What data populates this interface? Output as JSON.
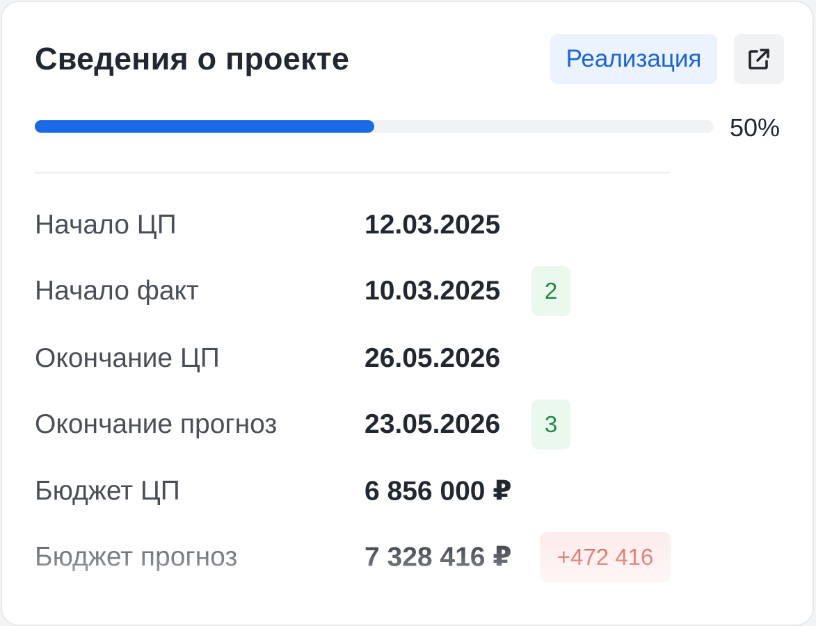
{
  "card": {
    "title": "Сведения о проекте",
    "status_label": "Реализация",
    "external_icon": "external-link-icon"
  },
  "progress": {
    "value": 0.5,
    "label": "50%"
  },
  "rows": [
    {
      "label": "Начало ЦП",
      "value": "12.03.2025",
      "delta": null
    },
    {
      "label": "Начало факт",
      "value": "10.03.2025",
      "delta": "2",
      "delta_kind": "good"
    },
    {
      "label": "Окончание ЦП",
      "value": "26.05.2026",
      "delta": null
    },
    {
      "label": "Окончание прогноз",
      "value": "23.05.2026",
      "delta": "3",
      "delta_kind": "good"
    },
    {
      "label": "Бюджет ЦП",
      "value": "6 856 000 ₽",
      "delta": null
    },
    {
      "label": "Бюджет прогноз",
      "value": "7 328 416 ₽",
      "delta": "+472 416",
      "delta_kind": "bad"
    }
  ],
  "colors": {
    "accent": "#1a6ae6",
    "status_bg": "#eaf3fe",
    "status_text": "#1a63d8",
    "good_bg": "#eaf8ee",
    "good_text": "#1e8a45",
    "bad_bg": "#fdeceb",
    "bad_text": "#d9534b"
  }
}
